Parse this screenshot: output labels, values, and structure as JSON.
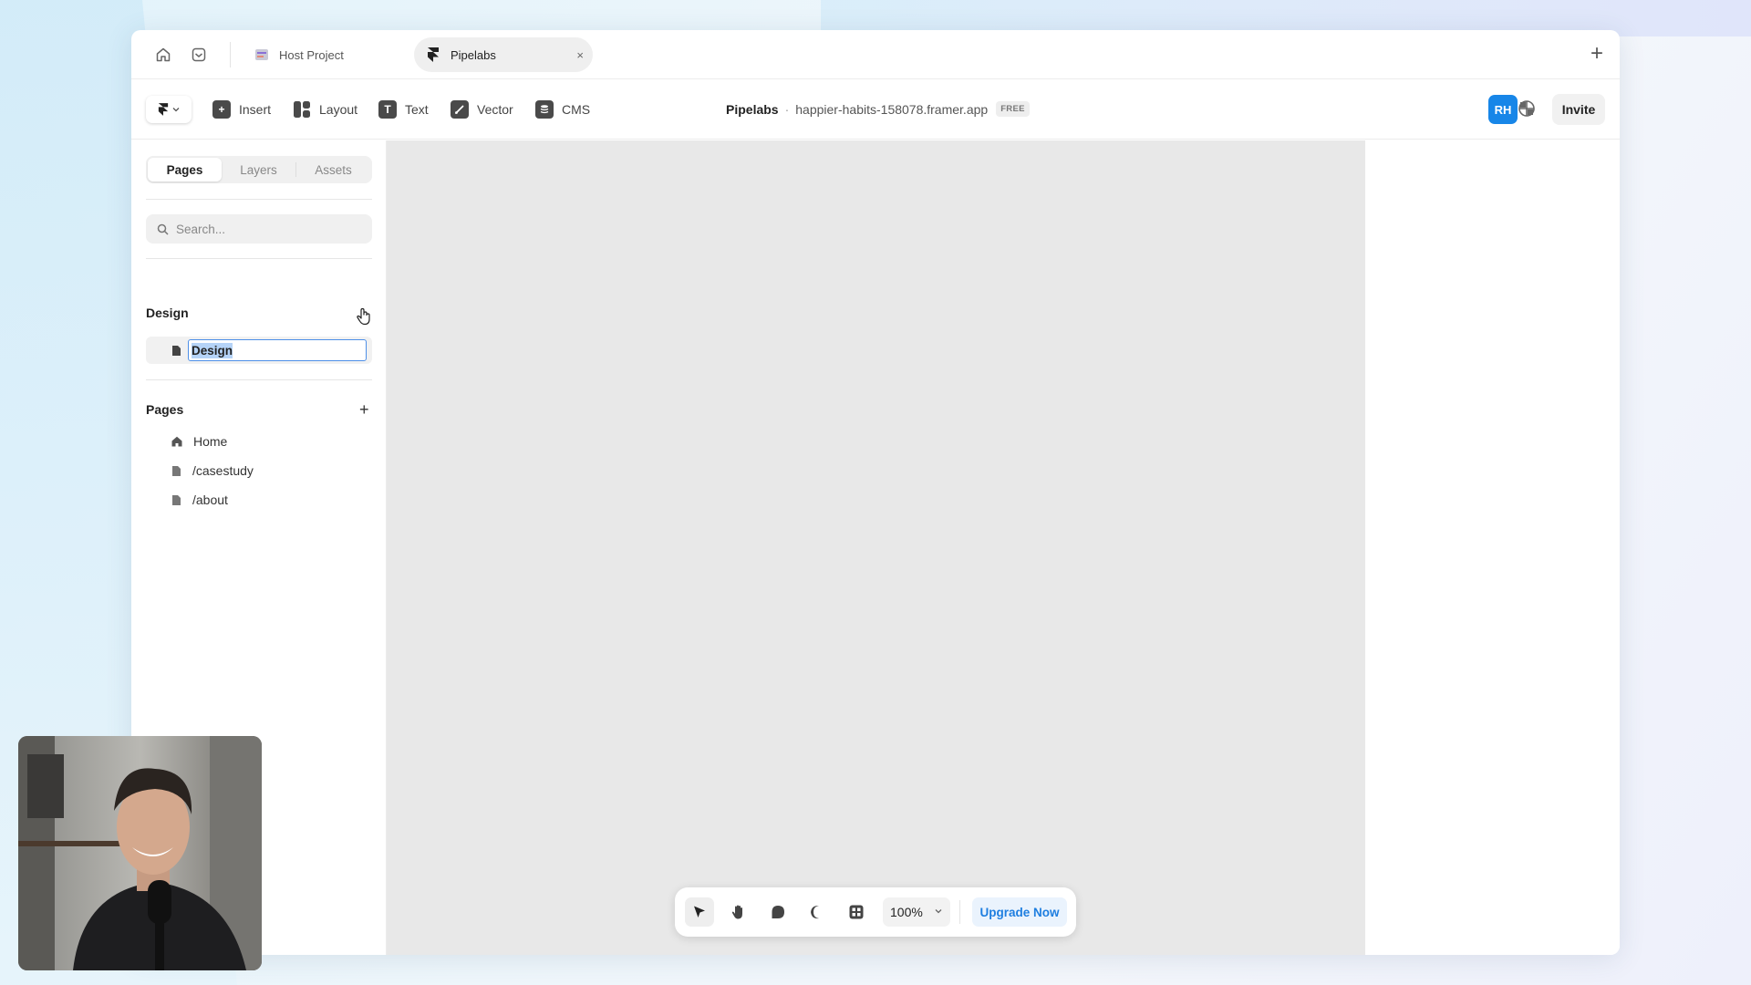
{
  "tabs": {
    "home_icon": "home-icon",
    "inbox_icon": "inbox-icon",
    "host_tab_label": "Host Project",
    "active_tab_label": "Pipelabs",
    "close_glyph": "×",
    "new_tab_glyph": "+"
  },
  "toolbar": {
    "insert_label": "Insert",
    "layout_label": "Layout",
    "text_label": "Text",
    "vector_label": "Vector",
    "cms_label": "CMS",
    "project_name": "Pipelabs",
    "separator": "·",
    "domain": "happier-habits-158078.framer.app",
    "plan_badge": "FREE",
    "avatar_initials": "RH",
    "invite_label": "Invite"
  },
  "sidebar": {
    "tabs": [
      "Pages",
      "Layers",
      "Assets"
    ],
    "active_tab": "Pages",
    "search_placeholder": "Search...",
    "design_section_title": "Design",
    "design_rename_value": "Design",
    "pages_section_title": "Pages",
    "pages_add_glyph": "+",
    "pages": [
      {
        "label": "Home",
        "icon": "home-icon"
      },
      {
        "label": "/casestudy",
        "icon": "page-icon"
      },
      {
        "label": "/about",
        "icon": "page-icon"
      }
    ]
  },
  "bottom_toolbar": {
    "zoom_value": "100%",
    "upgrade_label": "Upgrade Now",
    "tools": [
      "select-tool-icon",
      "hand-tool-icon",
      "comment-icon",
      "dark-mode-icon",
      "grid-icon"
    ]
  },
  "colors": {
    "accent_blue": "#1786e8",
    "upgrade_text": "#1e7ee0",
    "canvas_bg": "#e8e8e8"
  }
}
